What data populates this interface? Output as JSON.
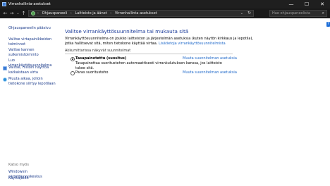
{
  "window": {
    "title": "Virranhallinta-asetukset",
    "controls": {
      "minimize": "—",
      "maximize": "☐",
      "close": "✕"
    }
  },
  "address": {
    "back": "←",
    "forward": "→",
    "history": "⌄",
    "up": "↑",
    "breadcrumbs": [
      "Ohjauspaneeli",
      "Laitteisto ja äänet",
      "Virranhallinta-asetukset"
    ],
    "separator": "›",
    "dropdown": "⌄",
    "refresh": "↻",
    "search_placeholder": "Hae ohjauspaneelista",
    "search_icon": "⌕",
    "help_icon": "?"
  },
  "sidebar": {
    "items": [
      {
        "label": "Ohjauspaneelin pääsivu",
        "icon": ""
      },
      {
        "label": "Valitse virtapainikkeiden toiminnot",
        "icon": ""
      },
      {
        "label": "Valitse kannen sulkemistoiminto",
        "icon": ""
      },
      {
        "label": "Luo virrankäyttösuunnitelma",
        "icon": ""
      },
      {
        "label": "Valitse, milloin näyttöä katkaistaan virta",
        "icon": "display-icon"
      },
      {
        "label": "Muuta aikaa, jolloin tietokone siirtyy lepotilaan",
        "icon": "sleep-icon"
      }
    ],
    "see_also_label": "Katso myös",
    "see_also": [
      "Windowsin siirrettävyyskeskus",
      "Käyttäjätilit"
    ]
  },
  "main": {
    "heading": "Valitse virrankäyttösuunnitelma tai mukauta sitä",
    "description": "Virrankäyttösuunnitelma on joukko laitteiston ja järjestelmän asetuksia (kuten näytön kirkkaus ja lepotila), jotka hallitsevat sitä, miten tietokone käyttää virtaa.",
    "description_link": "Lisätietoja virrankäyttösuunnitelmista",
    "group_label": "Akkumittarissa näkyvät suunnitelmat",
    "plans": [
      {
        "name": "Tasapainotettu (suositus)",
        "selected": true,
        "description": "Tasapainottaa suoritustehon automaattisesti virrankulutuksen kanssa, jos laitteisto tukee sitä.",
        "change_link": "Muuta suunnitelman asetuksia"
      },
      {
        "name": "Paras suoritusteho",
        "selected": false,
        "description": "",
        "change_link": "Muuta suunnitelman asetuksia"
      }
    ]
  },
  "colors": {
    "titlebar": "#1f1f1f",
    "link": "#1b66c9",
    "heading": "#1b3b99",
    "sidebar_link": "#1a3a8a"
  }
}
